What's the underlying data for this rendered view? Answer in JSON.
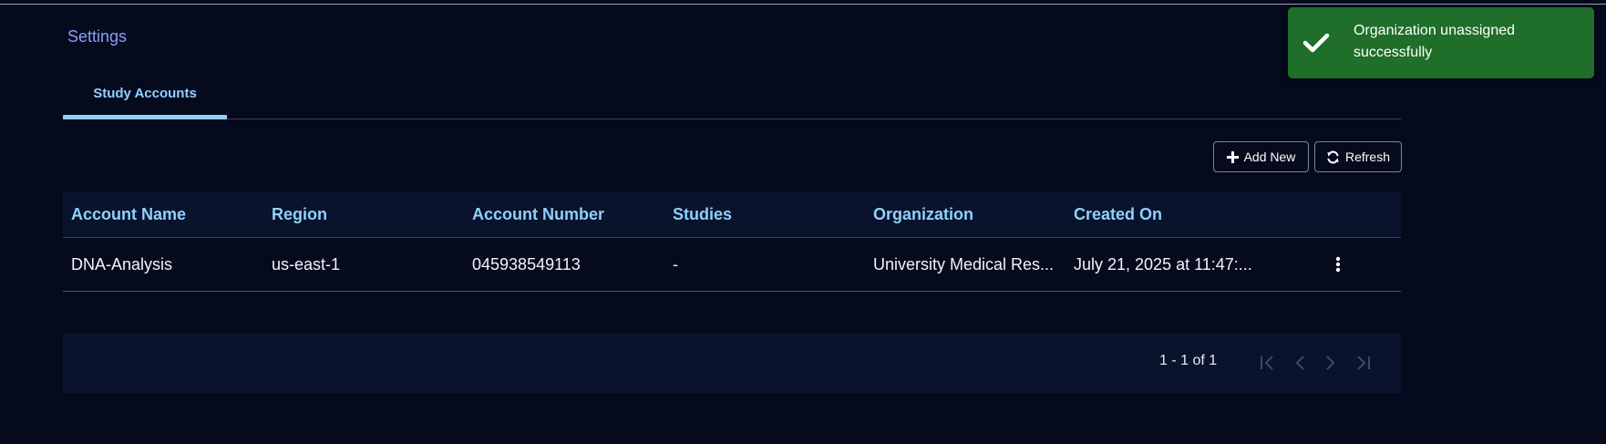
{
  "breadcrumb": "Settings",
  "tabs": [
    {
      "label": "Study Accounts",
      "active": true
    }
  ],
  "toolbar": {
    "add_label": "Add New",
    "refresh_label": "Refresh"
  },
  "table": {
    "columns": [
      "Account Name",
      "Region",
      "Account Number",
      "Studies",
      "Organization",
      "Created On"
    ],
    "rows": [
      {
        "account_name": "DNA-Analysis",
        "region": "us-east-1",
        "account_number": "045938549113",
        "studies": "-",
        "organization": "University Medical Res...",
        "created_on": "July 21, 2025 at 11:47:..."
      }
    ]
  },
  "paginator": {
    "range_label": "1 - 1 of 1"
  },
  "toast": {
    "message": "Organization unassigned successfully",
    "status": "success",
    "color": "#1f6f2a"
  },
  "colors": {
    "background": "#050a1c",
    "accent": "#8fd0ff",
    "link": "#8a9dff",
    "surface": "#09132b"
  },
  "icons": {
    "add": "plus-icon",
    "refresh": "refresh-icon",
    "row_menu": "more-vertical-icon",
    "first": "first-page-icon",
    "prev": "chevron-left-icon",
    "next": "chevron-right-icon",
    "last": "last-page-icon",
    "toast": "checkmark-icon"
  }
}
